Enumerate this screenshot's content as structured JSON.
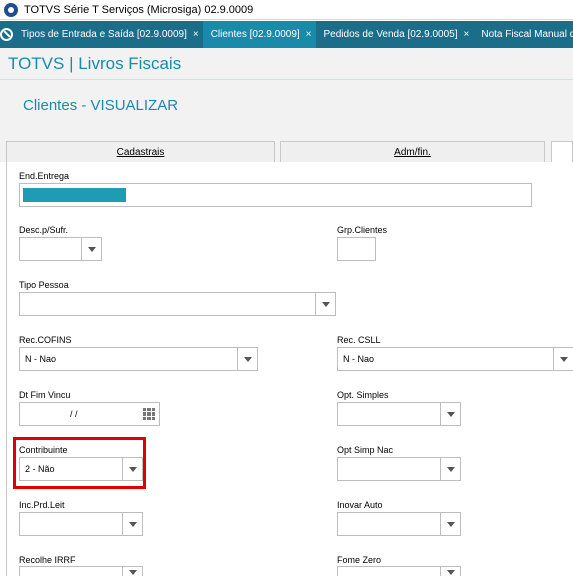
{
  "window": {
    "title": "TOTVS Série T Serviços (Microsiga) 02.9.0009"
  },
  "tabs": [
    {
      "label": "Tipos de Entrada e Saída [02.9.0009]",
      "close": "×"
    },
    {
      "label": "Clientes [02.9.0009]",
      "close": "×"
    },
    {
      "label": "Pedidos de Venda [02.9.0005]",
      "close": "×"
    },
    {
      "label": "Nota Fiscal Manual de Entra",
      "close": ""
    }
  ],
  "header": {
    "brand": "TOTVS | Livros Fiscais",
    "view_title": "Clientes - VISUALIZAR"
  },
  "folders": {
    "cadastrais": "Cadastrais",
    "admfin": "Adm/fin."
  },
  "fields": {
    "end_entrega": {
      "label": "End.Entrega",
      "value": ""
    },
    "desc_sufr": {
      "label": "Desc.p/Sufr.",
      "value": ""
    },
    "grp_clientes": {
      "label": "Grp.Clientes",
      "value": ""
    },
    "tipo_pessoa": {
      "label": "Tipo Pessoa",
      "value": ""
    },
    "rec_cofins": {
      "label": "Rec.COFINS",
      "value": "N - Nao"
    },
    "rec_csll": {
      "label": "Rec. CSLL",
      "value": "N - Nao"
    },
    "dt_fim_vincu": {
      "label": "Dt Fim Vincu",
      "value": "/ /"
    },
    "opt_simples": {
      "label": "Opt. Simples",
      "value": ""
    },
    "contribuinte": {
      "label": "Contribuinte",
      "value": "2 - Não"
    },
    "opt_simp_nac": {
      "label": "Opt Simp Nac",
      "value": ""
    },
    "inc_prd_leit": {
      "label": "Inc.Prd.Leit",
      "value": ""
    },
    "inovar_auto": {
      "label": "Inovar Auto",
      "value": ""
    },
    "recolhe_irrf": {
      "label": "Recolhe IRRF",
      "value": ""
    },
    "fome_zero": {
      "label": "Fome Zero",
      "value": ""
    }
  },
  "colors": {
    "accent": "#1a8aab",
    "tabbar": "#1b6e8a",
    "highlight": "#e00000"
  }
}
